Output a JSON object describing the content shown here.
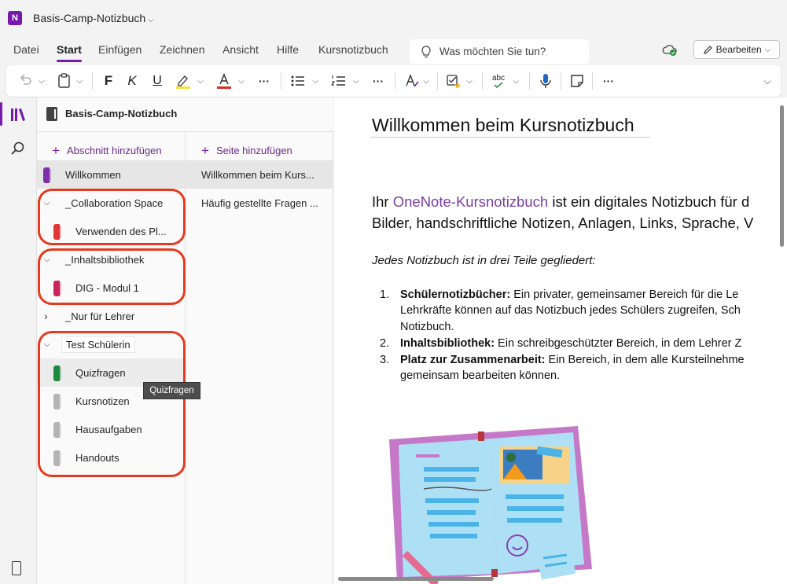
{
  "app": {
    "logo_letter": "N",
    "title": "Basis-Camp-Notizbuch",
    "title_chevron": "⌵"
  },
  "menu": {
    "tabs": [
      "Datei",
      "Start",
      "Einfügen",
      "Zeichnen",
      "Ansicht",
      "Hilfe",
      "Kursnotizbuch"
    ],
    "active": "Start",
    "search_placeholder": "Was möchten Sie tun?",
    "edit_label": "Bearbeiten",
    "edit_chevron": "⌵"
  },
  "ribbon": {
    "bold": "F",
    "italic": "K",
    "underline": "U",
    "more": "···",
    "spell": "abc",
    "chevron": "⌵"
  },
  "notebook": {
    "title": "Basis-Camp-Notizbuch",
    "add_section": "Abschnitt hinzufügen",
    "add_page": "Seite hinzufügen",
    "plus": "+"
  },
  "sections": {
    "willkommen": "Willkommen",
    "group1": {
      "caret": "⌵",
      "label": "_Collaboration Space",
      "child": "Verwenden des Pl..."
    },
    "group2": {
      "caret": "⌵",
      "label": "_Inhaltsbibliothek",
      "child": "DIG - Modul 1"
    },
    "group3": {
      "caret": "›",
      "label": "_Nur für Lehrer"
    },
    "group4": {
      "caret": "⌵",
      "label": "Test Schülerin",
      "children": [
        "Quizfragen",
        "Kursnotizen",
        "Hausaufgaben",
        "Handouts"
      ]
    },
    "tooltip": "Quizfragen"
  },
  "colors": {
    "brand": "#7719aa",
    "highlight_border": "#e53a1f",
    "tab_willkommen": "#7b2fa8",
    "tab_verwenden": "#e0353a",
    "tab_dig": "#c9245c",
    "tab_quiz": "#1e8a3e",
    "tab_grey": "#b4b4b4"
  },
  "pages": [
    "Willkommen beim Kurs...",
    "Häufig gestellte Fragen ..."
  ],
  "content": {
    "title": "Willkommen beim Kursnotizbuch",
    "p1_pre": "Ihr ",
    "p1_link": "OneNote-Kursnotizbuch",
    "p1_post": " ist ein digitales Notizbuch für d",
    "p2": "Bilder, handschriftliche Notizen, Anlagen, Links, Sprache, V",
    "intro": "Jedes Notizbuch ist in drei Teile gegliedert:",
    "items": [
      {
        "num": "1.",
        "bold": "Schülernotizbücher:",
        "text": " Ein privater, gemeinsamer Bereich für die Le",
        "cont": [
          "Lehrkräfte können auf das Notizbuch jedes Schülers zugreifen, Sch",
          "Notizbuch."
        ]
      },
      {
        "num": "2.",
        "bold": "Inhaltsbibliothek:",
        "text": " Ein schreibgeschützter Bereich, in dem Lehrer Z",
        "cont": []
      },
      {
        "num": "3.",
        "bold": "Platz zur Zusammenarbeit:",
        "text": " Ein Bereich, in dem alle Kursteilnehme",
        "cont": [
          "gemeinsam bearbeiten können."
        ]
      }
    ]
  }
}
